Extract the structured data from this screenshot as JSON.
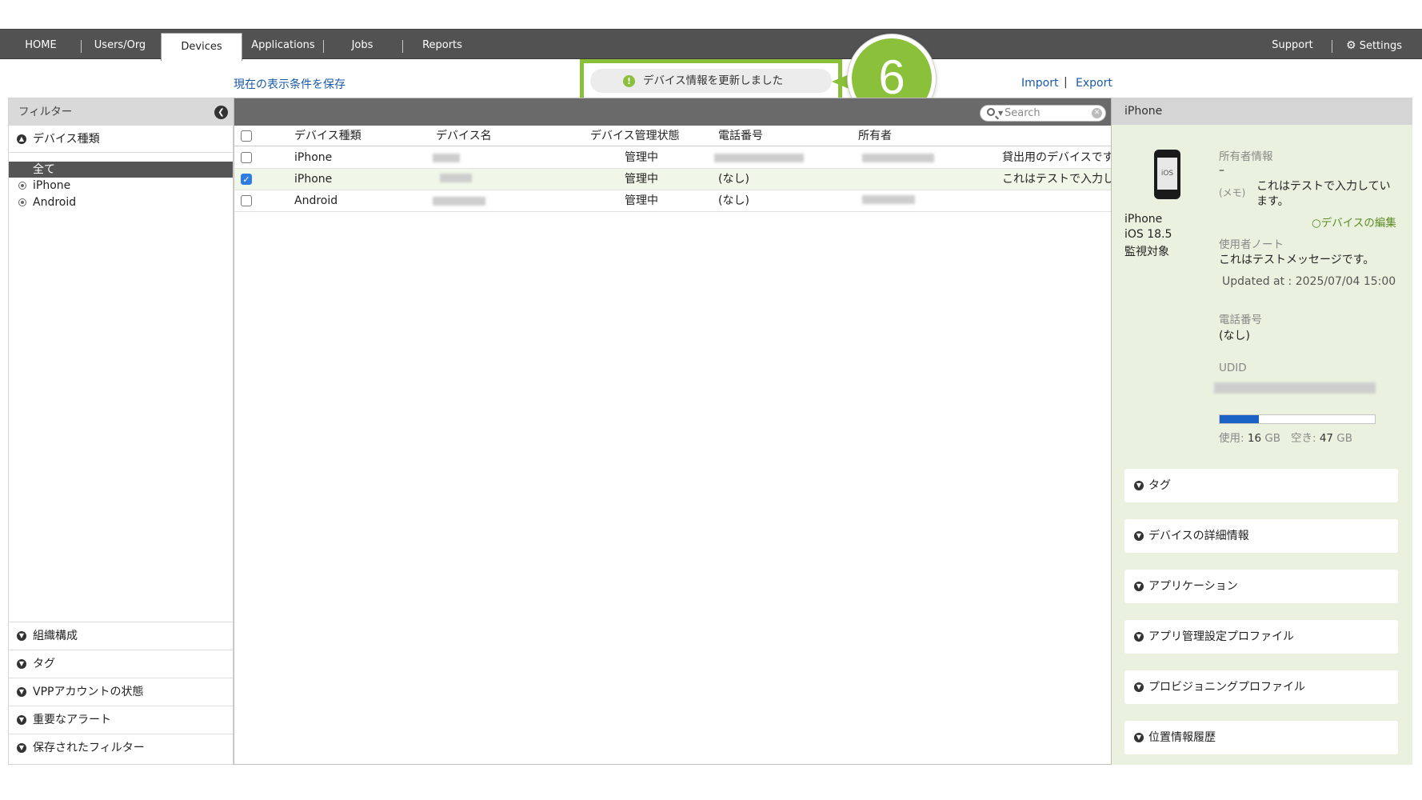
{
  "nav": {
    "items": [
      "HOME",
      "Users/Org",
      "Devices",
      "Applications",
      "Jobs",
      "Reports"
    ],
    "support": "Support",
    "settings": "Settings"
  },
  "toolbar": {
    "save_view": "現在の表示条件を保存",
    "import": "Import",
    "separator": "|",
    "export": "Export"
  },
  "toast": {
    "icon": "!",
    "message": "デバイス情報を更新しました",
    "step": "6"
  },
  "filter": {
    "title": "フィルター",
    "device_type_section": "デバイス種類",
    "options": [
      "全て",
      "iPhone",
      "Android"
    ],
    "sections": [
      "組織構成",
      "タグ",
      "VPPアカウントの状態",
      "重要なアラート",
      "保存されたフィルター"
    ]
  },
  "search": {
    "placeholder": "Search"
  },
  "table": {
    "columns": [
      "デバイス種類",
      "デバイス名",
      "デバイス管理状態",
      "電話番号",
      "所有者"
    ],
    "rows": [
      {
        "type": "iPhone",
        "status": "管理中",
        "phone": "",
        "memo": "貸出用のデバイスです",
        "checked": false
      },
      {
        "type": "iPhone",
        "status": "管理中",
        "phone": "(なし)",
        "memo": "これはテストで入力し",
        "checked": true
      },
      {
        "type": "Android",
        "status": "管理中",
        "phone": "(なし)",
        "memo": "",
        "checked": false
      }
    ]
  },
  "detail": {
    "title": "iPhone",
    "device_model": "iPhone",
    "os": "iOS 18.5",
    "supervision": "監視対象",
    "phone_icon_text": "iOS",
    "owner_info_label": "所有者情報",
    "owner_value": "–",
    "memo_label": "(メモ)",
    "memo_value_line1": "これはテストで入力してい",
    "memo_value_line2": "ます。",
    "edit_link": "デバイスの編集",
    "user_note_label": "使用者ノート",
    "user_note_value": "これはテストメッセージです。",
    "updated_at": "Updated at : 2025/07/04 15:00",
    "phone_label": "電話番号",
    "phone_value": "(なし)",
    "udid_label": "UDID",
    "storage_used_label": "使用:",
    "storage_used": "16",
    "storage_unit": "GB",
    "storage_free_label": "空き:",
    "storage_free": "47",
    "storage_used_fraction": 0.25,
    "sections": [
      "タグ",
      "デバイスの詳細情報",
      "アプリケーション",
      "アプリ管理設定プロファイル",
      "プロビジョニングプロファイル",
      "位置情報履歴"
    ]
  },
  "colors": {
    "nav_bg": "#525252",
    "accent_green": "#8bc03a",
    "link_blue": "#1a5aa8",
    "storage_blue": "#1b63c4",
    "detail_bg": "#eaf2df"
  }
}
